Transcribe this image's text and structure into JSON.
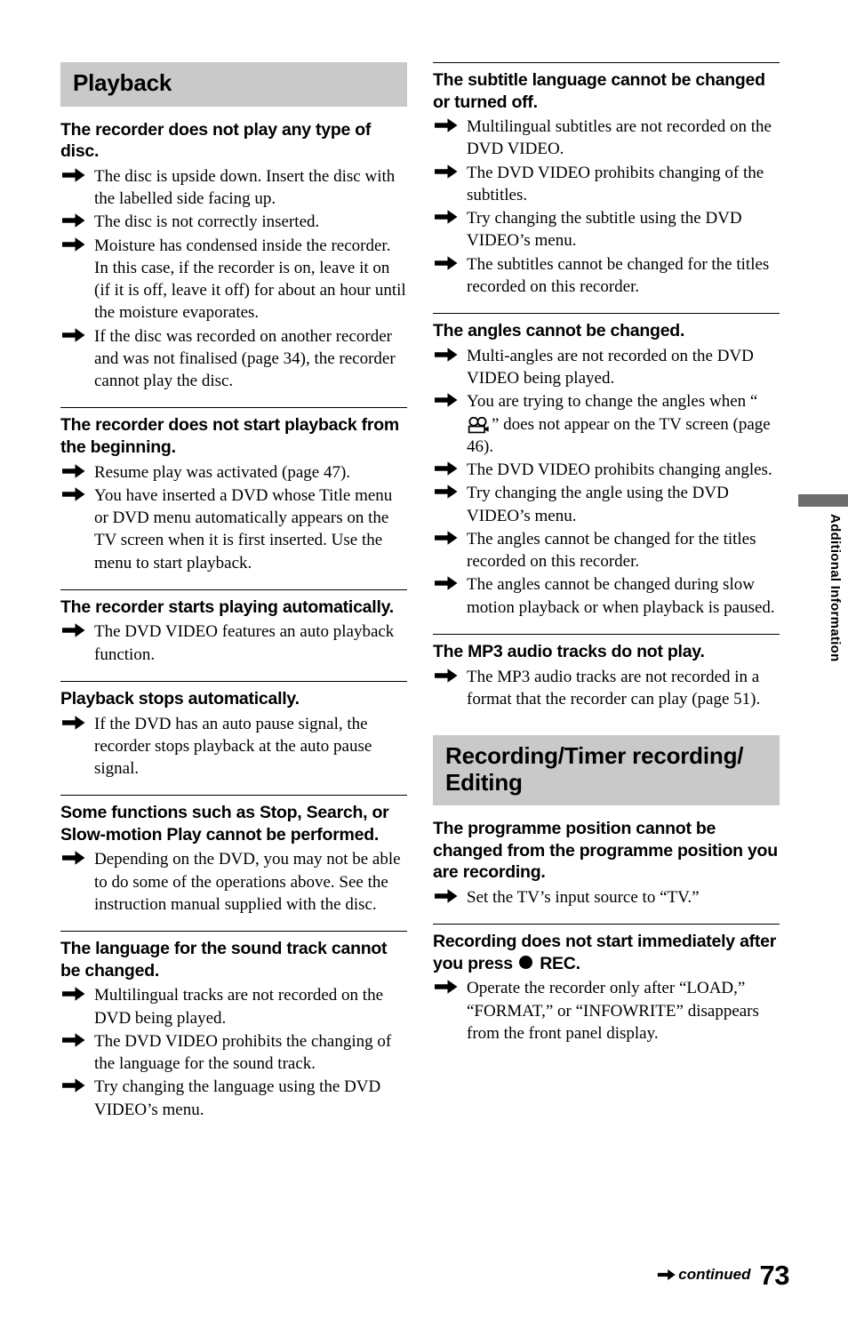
{
  "page": {
    "number": "73",
    "continued_label": "continued",
    "side_tab_label": "Additional Information",
    "banner_color": "#c9c9c9",
    "side_tab_bar_color": "#6d6d6d"
  },
  "left_column": {
    "section_title": "Playback",
    "blocks": [
      {
        "title": "The recorder does not play any type of disc.",
        "rule": false,
        "answers": [
          "The disc is upside down. Insert the disc with the labelled side facing up.",
          "The disc is not correctly inserted.",
          "Moisture has condensed inside the recorder. In this case, if the recorder is on, leave it on (if it is off, leave it off) for about an hour until the moisture evaporates.",
          "If the disc was recorded on another recorder and was not finalised (page 34), the recorder cannot play the disc."
        ]
      },
      {
        "title": "The recorder does not start playback from the beginning.",
        "rule": true,
        "answers": [
          "Resume play was activated (page 47).",
          "You have inserted a DVD whose Title menu or DVD menu automatically appears on the TV screen when it is first inserted. Use the menu to start playback."
        ]
      },
      {
        "title": "The recorder starts playing automatically.",
        "rule": true,
        "answers": [
          "The DVD VIDEO features an auto playback function."
        ]
      },
      {
        "title": "Playback stops automatically.",
        "rule": true,
        "answers": [
          "If the DVD has an auto pause signal, the recorder stops playback at the auto pause signal."
        ]
      },
      {
        "title": "Some functions such as Stop, Search, or Slow-motion Play cannot be performed.",
        "rule": true,
        "answers": [
          "Depending on the DVD, you may not be able to do some of the operations above. See the instruction manual supplied with the disc."
        ]
      },
      {
        "title": "The language for the sound track cannot be changed.",
        "rule": true,
        "answers": [
          "Multilingual tracks are not recorded on the DVD being played.",
          "The DVD VIDEO prohibits the changing of the language for the sound track.",
          "Try changing the language using the DVD VIDEO’s menu."
        ]
      }
    ]
  },
  "right_column": {
    "blocks_top": [
      {
        "title": "The subtitle language cannot be changed or turned off.",
        "rule": true,
        "answers": [
          "Multilingual subtitles are not recorded on the DVD VIDEO.",
          "The DVD VIDEO prohibits changing of the subtitles.",
          "Try changing the subtitle using the DVD VIDEO’s menu.",
          "The subtitles cannot be changed for the titles recorded on this recorder."
        ]
      },
      {
        "title": "The angles cannot be changed.",
        "rule": true,
        "answers_plain": [
          "Multi-angles are not recorded on the DVD VIDEO being played."
        ],
        "answer_with_icon_pre": "You are trying to change the angles when “",
        "answer_with_icon_post": "” does not appear on the TV screen (page 46).",
        "answer_icon_name": "camcorder-icon",
        "answers_after": [
          "The DVD VIDEO prohibits changing angles.",
          "Try changing the angle using the DVD VIDEO’s menu.",
          "The angles cannot be changed for the titles recorded on this recorder.",
          "The angles cannot be changed during slow motion playback or when playback is paused."
        ]
      },
      {
        "title": "The MP3 audio tracks do not play.",
        "rule": true,
        "answers": [
          "The MP3 audio tracks are not recorded in a format that the recorder can play (page 51)."
        ]
      }
    ],
    "section_title": "Recording/Timer recording/ Editing",
    "blocks_bottom": [
      {
        "title": "The programme position cannot be changed from the programme position you are recording.",
        "rule": false,
        "answers": [
          "Set the TV’s input source to “TV.”"
        ]
      },
      {
        "title_pre": "Recording does not start immediately after you press ",
        "title_post": " REC.",
        "title_icon_name": "rec-dot-icon",
        "rule": true,
        "answers": [
          "Operate the recorder only after “LOAD,” “FORMAT,” or “INFOWRITE” disappears from the front panel display."
        ]
      }
    ]
  }
}
